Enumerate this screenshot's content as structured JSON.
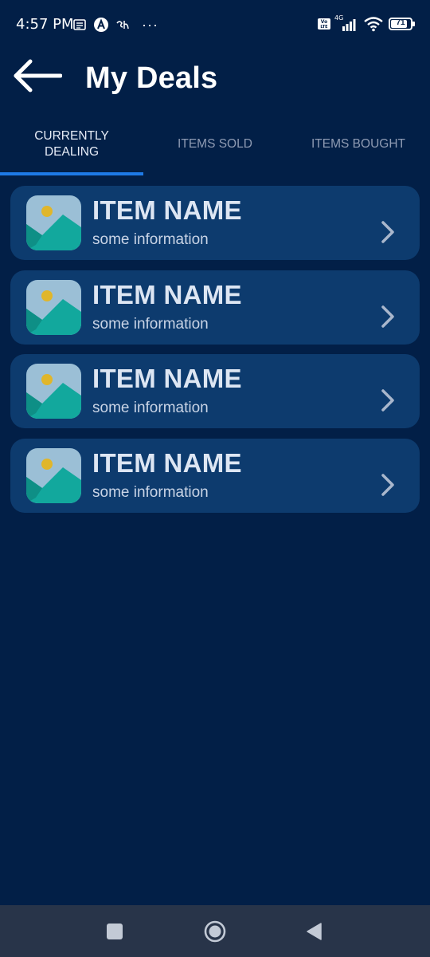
{
  "status_bar": {
    "time": "4:57 PM",
    "battery": "71",
    "network": "4G",
    "overflow": "···"
  },
  "header": {
    "title": "My Deals"
  },
  "tabs": [
    {
      "label_line1": "CURRENTLY",
      "label_line2": "DEALING",
      "active": true
    },
    {
      "label_line1": "ITEMS SOLD",
      "label_line2": "",
      "active": false
    },
    {
      "label_line1": "ITEMS BOUGHT",
      "label_line2": "",
      "active": false
    }
  ],
  "deals": [
    {
      "title": "ITEM NAME",
      "info": "some information"
    },
    {
      "title": "ITEM NAME",
      "info": "some information"
    },
    {
      "title": "ITEM NAME",
      "info": "some information"
    },
    {
      "title": "ITEM NAME",
      "info": "some information"
    }
  ],
  "icons": {
    "back": "arrow-left-icon",
    "chevron": "chevron-right-icon",
    "thumbnail": "image-placeholder-icon",
    "nav_recents": "square-icon",
    "nav_home": "circle-icon",
    "nav_back": "triangle-back-icon"
  },
  "colors": {
    "background": "#021f47",
    "card": "#0d3b6e",
    "tab_indicator": "#1e7ae6",
    "nav_bar": "#283449",
    "thumb_sky": "#9bbfd6",
    "thumb_mountain": "#12a89d",
    "thumb_sun": "#e0b62b"
  }
}
